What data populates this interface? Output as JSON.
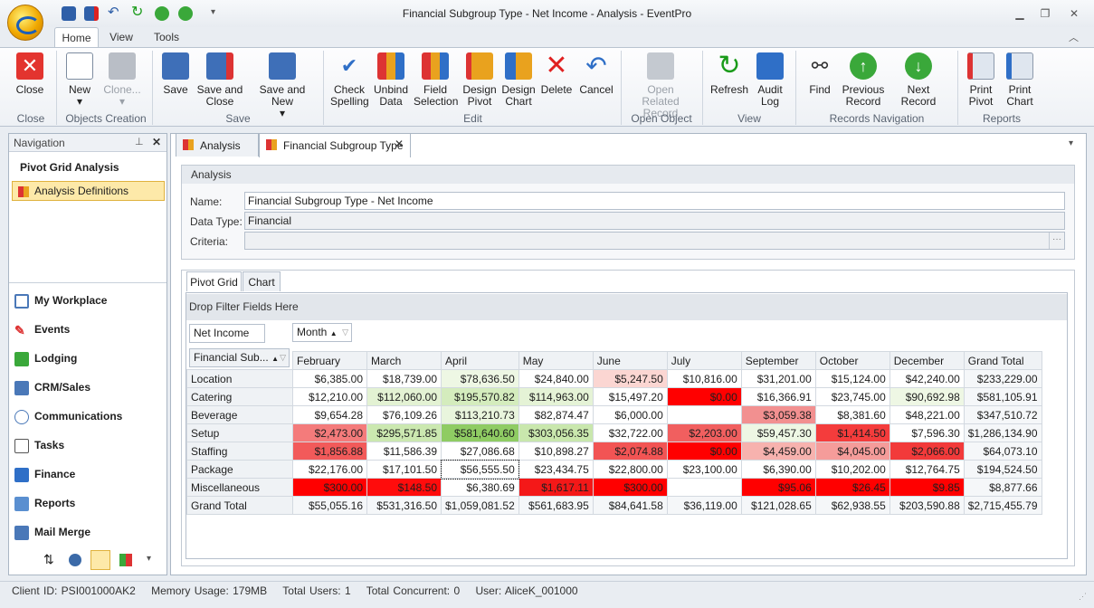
{
  "window": {
    "title": "Financial Subgroup Type - Net Income - Analysis - EventPro"
  },
  "ribbon_tabs": [
    "Home",
    "View",
    "Tools"
  ],
  "ribbon": {
    "close": "Close",
    "new": "New",
    "clone": "Clone...",
    "save": "Save",
    "save_close": "Save and Close",
    "save_new": "Save and New",
    "check_spelling": "Check Spelling",
    "unbind_data": "Unbind Data",
    "field_selection": "Field Selection",
    "design_pivot": "Design Pivot",
    "design_chart": "Design Chart",
    "delete": "Delete",
    "cancel": "Cancel",
    "open_related": "Open Related Record",
    "refresh": "Refresh",
    "audit_log": "Audit Log",
    "find": "Find",
    "previous_record": "Previous Record",
    "next_record": "Next Record",
    "print_pivot": "Print Pivot",
    "print_chart": "Print Chart",
    "groups": {
      "close": "Close",
      "objects_creation": "Objects Creation",
      "save": "Save",
      "edit": "Edit",
      "open_object": "Open Object",
      "view": "View",
      "records_navigation": "Records Navigation",
      "reports": "Reports"
    }
  },
  "navigation": {
    "header": "Navigation",
    "section_title": "Pivot Grid Analysis",
    "selected_item": "Analysis Definitions",
    "items": [
      "My Workplace",
      "Events",
      "Lodging",
      "CRM/Sales",
      "Communications",
      "Tasks",
      "Finance",
      "Reports",
      "Mail Merge"
    ]
  },
  "doc_tabs": [
    "Analysis",
    "Financial Subgroup Type"
  ],
  "analysis": {
    "group_title": "Analysis",
    "name_label": "Name:",
    "name_value": "Financial Subgroup Type - Net Income",
    "datatype_label": "Data Type:",
    "datatype_value": "Financial",
    "criteria_label": "Criteria:",
    "criteria_value": "",
    "ellipsis": "···"
  },
  "pivot_tabs": [
    "Pivot Grid",
    "Chart"
  ],
  "pivot": {
    "drop_filter": "Drop Filter Fields Here",
    "data_field": "Net Income",
    "column_field": "Month",
    "row_field": "Financial Sub...",
    "columns": [
      "February",
      "March",
      "April",
      "May",
      "June",
      "July",
      "September",
      "October",
      "December",
      "Grand Total"
    ],
    "rows": [
      {
        "label": "Location",
        "values": [
          "$6,385.00",
          "$18,739.00",
          "$78,636.50",
          "$24,840.00",
          "$5,247.50",
          "$10,816.00",
          "$31,201.00",
          "$15,124.00",
          "$42,240.00",
          "$233,229.00"
        ]
      },
      {
        "label": "Catering",
        "values": [
          "$12,210.00",
          "$112,060.00",
          "$195,570.82",
          "$114,963.00",
          "$15,497.20",
          "$0.00",
          "$16,366.91",
          "$23,745.00",
          "$90,692.98",
          "$581,105.91"
        ]
      },
      {
        "label": "Beverage",
        "values": [
          "$9,654.28",
          "$76,109.26",
          "$113,210.73",
          "$82,874.47",
          "$6,000.00",
          "",
          "$3,059.38",
          "$8,381.60",
          "$48,221.00",
          "$347,510.72"
        ]
      },
      {
        "label": "Setup",
        "values": [
          "$2,473.00",
          "$295,571.85",
          "$581,640.60",
          "$303,056.35",
          "$32,722.00",
          "$2,203.00",
          "$59,457.30",
          "$1,414.50",
          "$7,596.30",
          "$1,286,134.90"
        ]
      },
      {
        "label": "Staffing",
        "values": [
          "$1,856.88",
          "$11,586.39",
          "$27,086.68",
          "$10,898.27",
          "$2,074.88",
          "$0.00",
          "$4,459.00",
          "$4,045.00",
          "$2,066.00",
          "$64,073.10"
        ]
      },
      {
        "label": "Package",
        "values": [
          "$22,176.00",
          "$17,101.50",
          "$56,555.50",
          "$23,434.75",
          "$22,800.00",
          "$23,100.00",
          "$6,390.00",
          "$10,202.00",
          "$12,764.75",
          "$194,524.50"
        ]
      },
      {
        "label": "Miscellaneous",
        "values": [
          "$300.00",
          "$148.50",
          "$6,380.69",
          "$1,617.11",
          "$300.00",
          "",
          "$95.06",
          "$26.45",
          "$9.85",
          "$8,877.66"
        ]
      },
      {
        "label": "Grand Total",
        "values": [
          "$55,055.16",
          "$531,316.50",
          "$1,059,081.52",
          "$561,683.95",
          "$84,641.58",
          "$36,119.00",
          "$121,028.65",
          "$62,938.55",
          "$203,590.88",
          "$2,715,455.79"
        ]
      }
    ],
    "cell_colors": [
      [
        "",
        "",
        "#eef7e4",
        "",
        "#fbd6d2",
        "",
        "",
        "",
        "",
        ""
      ],
      [
        "",
        "#e3f2d3",
        "#d4ecbd",
        "#e5f3d6",
        "",
        "#ff0000",
        "",
        "",
        "#eef7e4",
        ""
      ],
      [
        "",
        "",
        "#e9f5dd",
        "",
        "",
        "",
        "#f29090",
        "",
        "",
        ""
      ],
      [
        "#f47b7b",
        "#cbe8b0",
        "#8fcc63",
        "#c9e7ad",
        "",
        "#f15f5f",
        "#eef7e4",
        "#f43c3c",
        "",
        ""
      ],
      [
        "#f25a5a",
        "",
        "",
        "",
        "#f25454",
        "#ff0000",
        "#f7b2ae",
        "#f59c9a",
        "#f23a3a",
        ""
      ],
      [
        "",
        "",
        "",
        "",
        "",
        "",
        "",
        "",
        "",
        ""
      ],
      [
        "#ff0000",
        "#ff0c0c",
        "",
        "#f41818",
        "#ff0000",
        "",
        "#ff0000",
        "#ff0000",
        "#ff0000",
        ""
      ],
      [
        "",
        "",
        "",
        "",
        "",
        "",
        "",
        "",
        "",
        ""
      ]
    ]
  },
  "status": {
    "client_id": "Client ID: PSI001000AK2",
    "memory": "Memory Usage: 179MB",
    "total_users": "Total Users: 1",
    "total_concurrent": "Total Concurrent: 0",
    "user": "User: AliceK_001000"
  }
}
